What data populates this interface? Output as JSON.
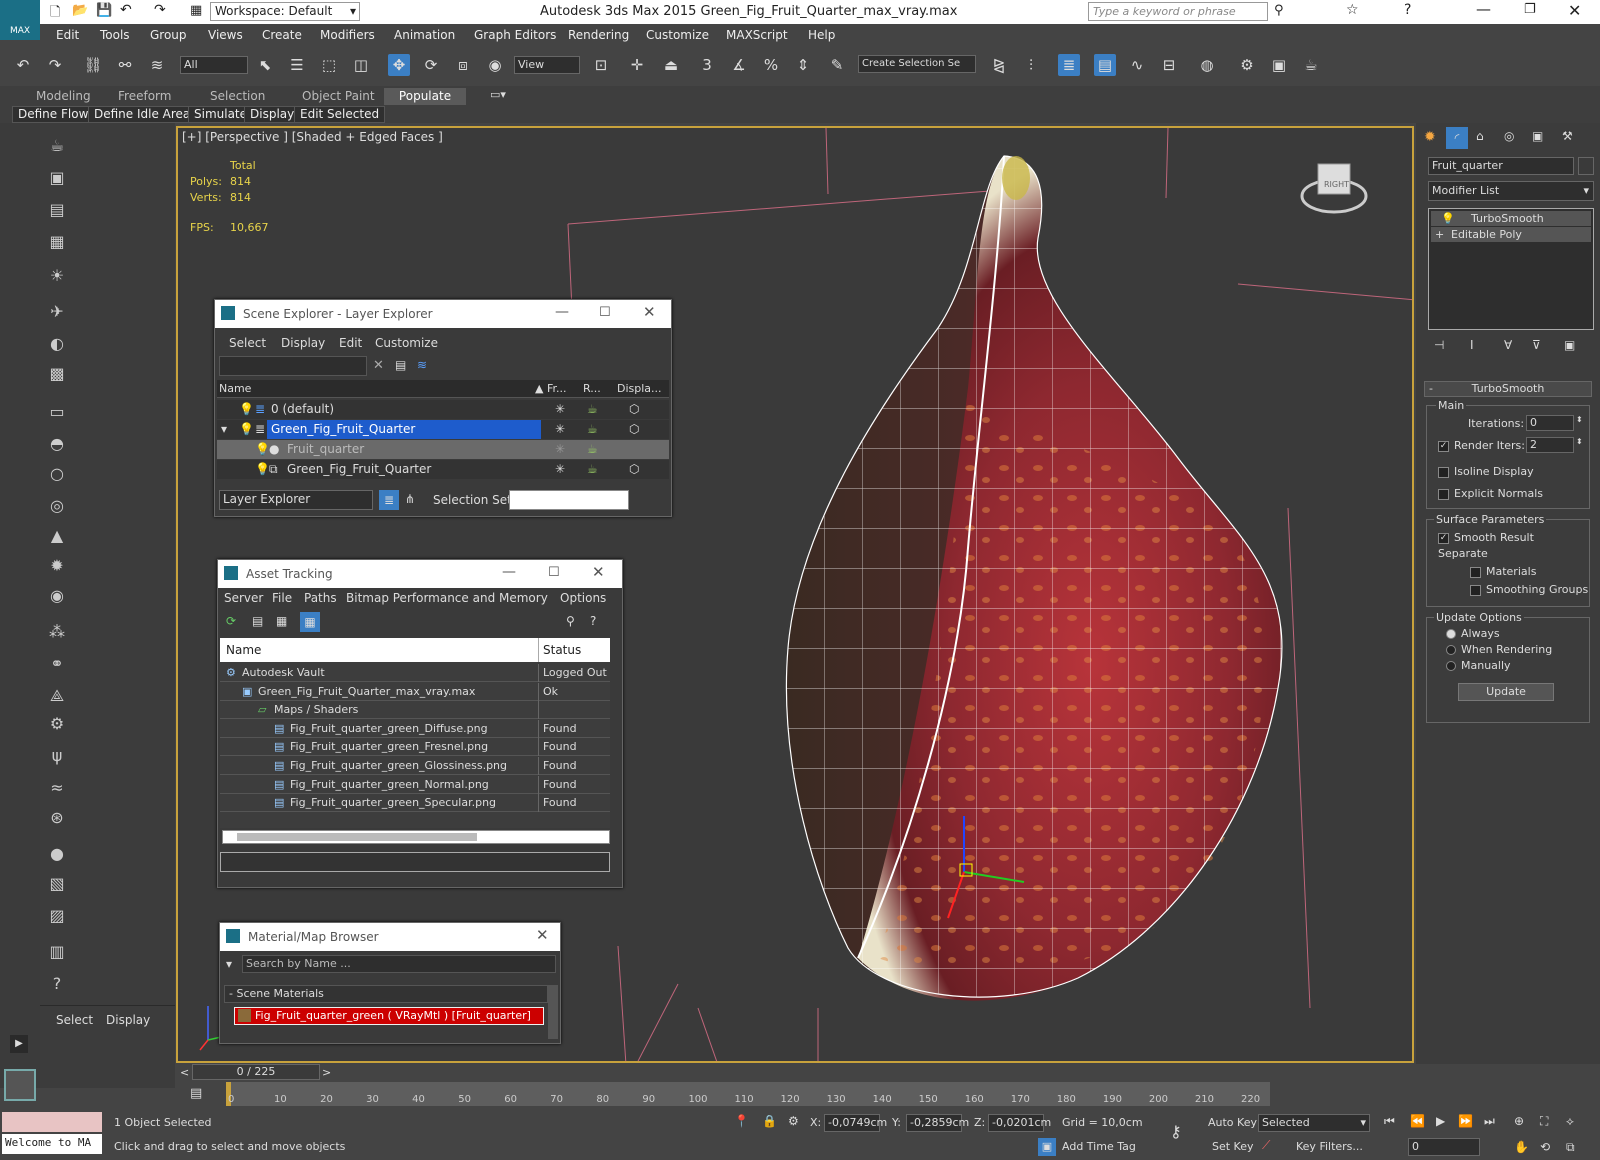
{
  "app": {
    "title": "Autodesk 3ds Max  2015     Green_Fig_Fruit_Quarter_max_vray.max",
    "workspace": "Workspace: Default",
    "search_placeholder": "Type a keyword or phrase",
    "logo": "MAX"
  },
  "menu": [
    "Edit",
    "Tools",
    "Group",
    "Views",
    "Create",
    "Modifiers",
    "Animation",
    "Graph Editors",
    "Rendering",
    "Customize",
    "MAXScript",
    "Help"
  ],
  "toolbar": {
    "filter": "All",
    "refcoord": "View",
    "selection_set_placeholder": "Create Selection Se"
  },
  "ribbon": {
    "tabs": [
      "Modeling",
      "Freeform",
      "Selection",
      "Object Paint",
      "Populate"
    ],
    "active": "Populate",
    "subtabs": [
      "Define Flows",
      "Define Idle Areas",
      "Simulate",
      "Display",
      "Edit Selected"
    ]
  },
  "viewport": {
    "label": "[+] [Perspective ] [Shaded + Edged Faces ]",
    "stats": {
      "total_label": "Total",
      "polys_label": "Polys:",
      "polys": "814",
      "verts_label": "Verts:",
      "verts": "814",
      "fps_label": "FPS:",
      "fps": "10,667"
    },
    "cube": "RIGHT"
  },
  "scene_explorer": {
    "title": "Scene Explorer - Layer Explorer",
    "menu": [
      "Select",
      "Display",
      "Edit",
      "Customize"
    ],
    "columns": [
      "Name",
      "Fr...",
      "R...",
      "Displa..."
    ],
    "rows": [
      "0 (default)",
      "Green_Fig_Fruit_Quarter",
      "Fruit_quarter",
      "Green_Fig_Fruit_Quarter"
    ],
    "footer_mode": "Layer Explorer",
    "selection_set_label": "Selection Set:"
  },
  "asset_tracking": {
    "title": "Asset Tracking",
    "menu": [
      "Server",
      "File",
      "Paths",
      "Bitmap Performance and Memory",
      "Options"
    ],
    "columns": [
      "Name",
      "Status"
    ],
    "rows": [
      {
        "name": "Autodesk Vault",
        "status": "Logged Out ."
      },
      {
        "name": "Green_Fig_Fruit_Quarter_max_vray.max",
        "status": "Ok"
      },
      {
        "name": "Maps / Shaders",
        "status": ""
      },
      {
        "name": "Fig_Fruit_quarter_green_Diffuse.png",
        "status": "Found"
      },
      {
        "name": "Fig_Fruit_quarter_green_Fresnel.png",
        "status": "Found"
      },
      {
        "name": "Fig_Fruit_quarter_green_Glossiness.png",
        "status": "Found"
      },
      {
        "name": "Fig_Fruit_quarter_green_Normal.png",
        "status": "Found"
      },
      {
        "name": "Fig_Fruit_quarter_green_Specular.png",
        "status": "Found"
      }
    ]
  },
  "material_browser": {
    "title": "Material/Map Browser",
    "search_placeholder": "Search by Name ...",
    "group": "- Scene Materials",
    "item": "Fig_Fruit_quarter_green  ( VRayMtl )  [Fruit_quarter]"
  },
  "command_panel": {
    "object_name": "Fruit_quarter",
    "modifier_list": "Modifier List",
    "stack": [
      "TurboSmooth",
      "Editable Poly"
    ],
    "rollout": "TurboSmooth",
    "main": "Main",
    "iterations_label": "Iterations:",
    "iterations": "0",
    "render_iters_label": "Render Iters:",
    "render_iters": "2",
    "isoline": "Isoline Display",
    "explicit": "Explicit Normals",
    "surface": "Surface Parameters",
    "smooth_result": "Smooth Result",
    "separate": "Separate",
    "materials": "Materials",
    "smoothing_groups": "Smoothing Groups",
    "update_options": "Update Options",
    "always": "Always",
    "when_rendering": "When Rendering",
    "manually": "Manually",
    "update_btn": "Update"
  },
  "left_panel": {
    "tabs": [
      "Select",
      "Display"
    ]
  },
  "timeline": {
    "frame": "0 / 225",
    "ticks": [
      "0",
      "10",
      "20",
      "30",
      "40",
      "50",
      "60",
      "70",
      "80",
      "90",
      "100",
      "110",
      "120",
      "130",
      "140",
      "150",
      "160",
      "170",
      "180",
      "190",
      "200",
      "210",
      "220"
    ]
  },
  "status": {
    "welcome": "Welcome to MA",
    "selected": "1 Object Selected",
    "prompt": "Click and drag to select and move objects",
    "x_label": "X:",
    "x": "-0,0749cm",
    "y_label": "Y:",
    "y": "-0,2859cm",
    "z_label": "Z:",
    "z": "-0,0201cm",
    "grid": "Grid = 10,0cm",
    "add_time_tag": "Add Time Tag",
    "auto_key": "Auto Key",
    "set_key": "Set Key",
    "key_mode": "Selected",
    "key_filters": "Key Filters...",
    "frame_field": "0"
  },
  "colors": {
    "accent": "#3b7fc4",
    "viewport_border": "#c8a23c",
    "selection_blue": "#1e5ccc",
    "material_red": "#cc0000",
    "stats_yellow": "#e8d44a"
  }
}
